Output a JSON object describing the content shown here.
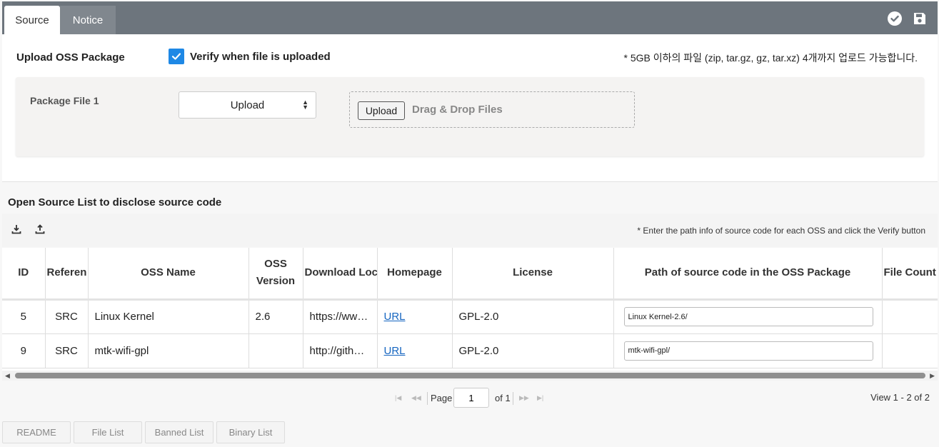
{
  "tabs": {
    "source": "Source",
    "notice": "Notice"
  },
  "toolbar": {
    "confirm_icon": "check-circle-icon",
    "save_icon": "save-icon"
  },
  "upload": {
    "title": "Upload OSS Package",
    "verify_label": "Verify when file is uploaded",
    "verify_checked": true,
    "size_note": "* 5GB 이하의 파일 (zip, tar.gz, gz, tar.xz) 4개까지 업로드 가능합니다.",
    "package": {
      "label": "Package File 1",
      "select_value": "Upload",
      "upload_button": "Upload",
      "drop_text": "Drag & Drop Files"
    }
  },
  "list": {
    "title": "Open Source List to disclose source code",
    "note": "* Enter the path info of source code for each OSS and click the Verify button",
    "columns": {
      "id": "ID",
      "reference": "Referen",
      "oss_name": "OSS Name",
      "oss_version": "OSS Version",
      "download": "Download Loc",
      "homepage": "Homepage",
      "license": "License",
      "path": "Path of source code in the OSS Package",
      "file_count": "File Count"
    },
    "rows": [
      {
        "id": "5",
        "ref": "SRC",
        "name": "Linux Kernel",
        "version": "2.6",
        "download": "https://www.kernel.org",
        "homepage": "URL",
        "license": "GPL-2.0",
        "path": "Linux Kernel-2.6/"
      },
      {
        "id": "9",
        "ref": "SRC",
        "name": "mtk-wifi-gpl",
        "version": "",
        "download": "http://github.com",
        "homepage": "URL",
        "license": "GPL-2.0",
        "path": "mtk-wifi-gpl/"
      }
    ]
  },
  "pager": {
    "page_label": "Page",
    "page_value": "1",
    "of_label": "of 1",
    "view_info": "View 1 - 2 of 2"
  },
  "bottom_tabs": {
    "readme": "README",
    "file_list": "File List",
    "banned_list": "Banned List",
    "binary_list": "Binary List"
  },
  "colors": {
    "tabbar": "#6d757d",
    "checkbox": "#1e88e5",
    "link": "#1565c0"
  }
}
